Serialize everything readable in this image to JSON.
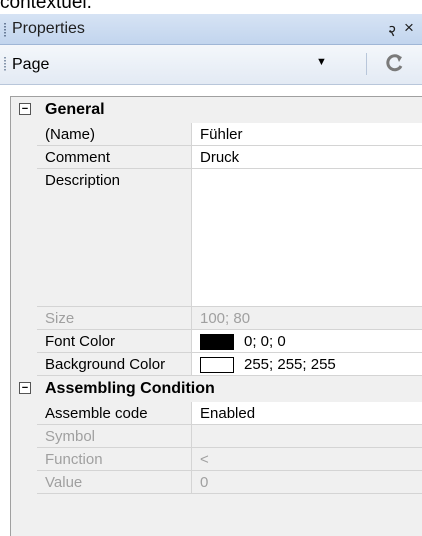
{
  "top_clip_text": "contextuel.",
  "panel": {
    "title": "Properties",
    "pin_glyph": "२",
    "close_glyph": "×",
    "object_combo_value": "Page",
    "combo_arrow": "▼"
  },
  "categories": [
    {
      "label": "General",
      "expander": "−",
      "rows": [
        {
          "name": "(Name)",
          "value": "Fühler",
          "enabled": true
        },
        {
          "name": "Comment",
          "value": "Druck",
          "enabled": true
        },
        {
          "name": "Description",
          "value": "",
          "enabled": true
        },
        {
          "name": "Size",
          "value": "100; 80",
          "enabled": false
        },
        {
          "name": "Font Color",
          "value": "0; 0; 0",
          "swatch": "#000000",
          "enabled": true
        },
        {
          "name": "Background Color",
          "value": "255; 255; 255",
          "swatch": "#ffffff",
          "enabled": true
        }
      ]
    },
    {
      "label": "Assembling Condition",
      "expander": "−",
      "rows": [
        {
          "name": "Assemble code",
          "value": "Enabled",
          "enabled": true
        },
        {
          "name": "Symbol",
          "value": "",
          "enabled": false
        },
        {
          "name": "Function",
          "value": "<",
          "enabled": false
        },
        {
          "name": "Value",
          "value": "0",
          "enabled": false
        }
      ]
    }
  ],
  "colors": {
    "titlebar": "#c9daf0",
    "grid_background": "#f0f0f0",
    "disabled_text": "#a0a0a0"
  }
}
